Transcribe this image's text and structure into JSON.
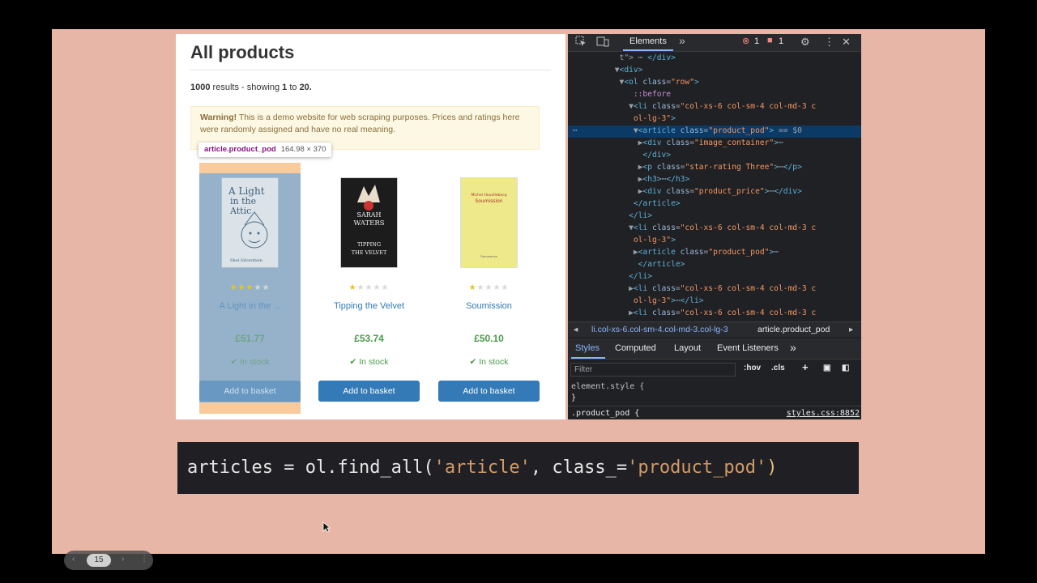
{
  "page": {
    "title": "All products",
    "results_count": "1000",
    "results_text_mid": " results - showing ",
    "results_from": "1",
    "results_to_word": " to ",
    "results_to": "20.",
    "warning_bold": "Warning!",
    "warning_text": " This is a demo website for web scraping purposes. Prices and ratings here were randomly assigned and have no real meaning.",
    "tooltip_selector": "article.product_pod",
    "tooltip_size": "164.98 × 370"
  },
  "products": [
    {
      "title": "A Light in the ...",
      "rating": 3,
      "price": "£51.77",
      "stock": "In stock",
      "button": "Add to basket",
      "cover_text": "A Light in the Attic",
      "cover_author": "Shel Silverstein"
    },
    {
      "title": "Tipping the Velvet",
      "rating": 1,
      "price": "£53.74",
      "stock": "In stock",
      "button": "Add to basket",
      "cover_author": "SARAH WATERS",
      "cover_text": "TIPPING THE VELVET"
    },
    {
      "title": "Soumission",
      "rating": 1,
      "price": "£50.10",
      "stock": "In stock",
      "button": "Add to basket",
      "cover_author": "Michel Houellebecq",
      "cover_text": "Soumission"
    }
  ],
  "devtools": {
    "tab_elements": "Elements",
    "more_tabs": "»",
    "error_count": "1",
    "issue_count": "1",
    "breadcrumb_1": "li.col-xs-6.col-sm-4.col-md-3.col-lg-3",
    "breadcrumb_2": "article.product_pod",
    "tabs": [
      "Styles",
      "Computed",
      "Layout",
      "Event Listeners",
      "»"
    ],
    "filter_placeholder": "Filter",
    "hov": ":hov",
    "cls": ".cls",
    "style_rule_1": "element.style {",
    "style_rule_1_end": "}",
    "style_rule_2": ".product_pod {",
    "style_link": "styles.css:8852"
  },
  "code": {
    "var": "articles",
    "op": " = ",
    "obj": "ol.find_all(",
    "arg1": "'article'",
    "comma": ", ",
    "kw": "class_=",
    "arg2": "'product_pod'",
    "close": ")"
  },
  "pager": {
    "current": "15"
  },
  "colors": {
    "accent": "#337ab7",
    "price": "#4c9a4c",
    "highlight": "#6fa8dc",
    "margin": "#f9cb9c",
    "slide_bg": "#e8b6a6"
  }
}
